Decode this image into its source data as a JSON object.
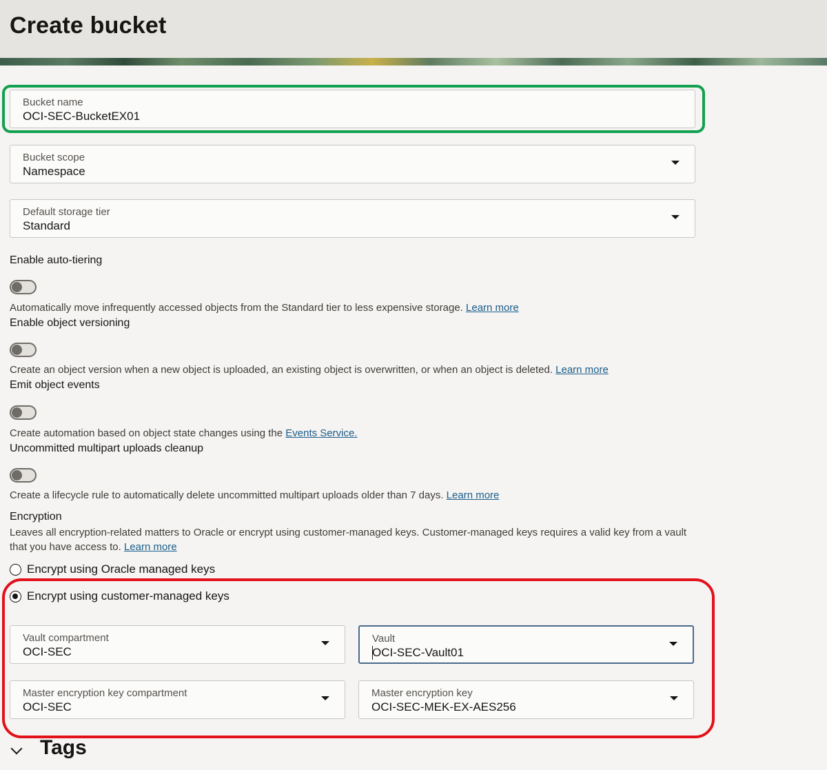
{
  "page": {
    "title": "Create bucket"
  },
  "bucket_name": {
    "label": "Bucket name",
    "value": "OCI-SEC-BucketEX01"
  },
  "bucket_scope": {
    "label": "Bucket scope",
    "value": "Namespace"
  },
  "storage_tier": {
    "label": "Default storage tier",
    "value": "Standard"
  },
  "auto_tiering": {
    "label": "Enable auto-tiering",
    "description": "Automatically move infrequently accessed objects from the Standard tier to less expensive storage.",
    "link": "Learn more",
    "enabled": false
  },
  "versioning": {
    "label": "Enable object versioning",
    "description": "Create an object version when a new object is uploaded, an existing object is overwritten, or when an object is deleted.",
    "link": "Learn more",
    "enabled": false
  },
  "events": {
    "label": "Emit object events",
    "description": "Create automation based on object state changes using the",
    "link": "Events Service.",
    "enabled": false
  },
  "multipart": {
    "label": "Uncommitted multipart uploads cleanup",
    "description": "Create a lifecycle rule to automatically delete uncommitted multipart uploads older than 7 days.",
    "link": "Learn more",
    "enabled": false
  },
  "encryption": {
    "label": "Encryption",
    "description_line1": "Leaves all encryption-related matters to Oracle or encrypt using customer-managed keys. Customer-managed keys requires a valid key from a vault",
    "description_line2": "that you have access to.",
    "link": "Learn more",
    "option_oracle": "Encrypt using Oracle managed keys",
    "option_customer": "Encrypt using customer-managed keys",
    "selected": "customer"
  },
  "vault_compartment": {
    "label": "Vault compartment",
    "value": "OCI-SEC"
  },
  "vault": {
    "label": "Vault",
    "value": "OCI-SEC-Vault01"
  },
  "key_compartment": {
    "label": "Master encryption key compartment",
    "value": "OCI-SEC"
  },
  "master_key": {
    "label": "Master encryption key",
    "value": "OCI-SEC-MEK-EX-AES256"
  },
  "tags": {
    "title": "Tags"
  },
  "colors": {
    "highlight_green": "#12a150",
    "highlight_red": "#e2111a",
    "link": "#1a5c8a"
  }
}
